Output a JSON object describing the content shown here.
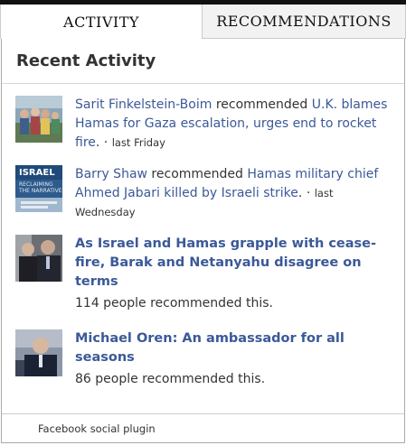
{
  "tabs": {
    "activity": "ACTIVITY",
    "recommendations": "RECOMMENDATIONS"
  },
  "plugin": {
    "heading": "Recent Activity",
    "footer": "Facebook social plugin"
  },
  "items": [
    {
      "actor": "Sarit Finkelstein-Boim",
      "verb": " recommended ",
      "article": "U.K. blames Hamas for Gaza escalation, urges end to rocket fire",
      "sep": ". · ",
      "time": "last Friday"
    },
    {
      "actor": "Barry Shaw",
      "verb": " recommended ",
      "article": "Hamas military chief Ahmed Jabari killed by Israeli strike",
      "sep": ". · ",
      "time": "last Wednesday"
    },
    {
      "title": "As Israel and Hamas grapple with cease-fire, Barak and Netanyahu disagree on terms",
      "count": "114 people recommended this."
    },
    {
      "title": "Michael Oren: An ambassador for all seasons",
      "count": "86 people recommended this."
    }
  ],
  "thumb_text": {
    "item1_a": "ISRAEL",
    "item1_b": "RECLAIMING",
    "item1_c": "THE NARRATIVE"
  },
  "colors": {
    "link": "#3b5998",
    "text": "#333333",
    "border": "#aaaaaa"
  }
}
